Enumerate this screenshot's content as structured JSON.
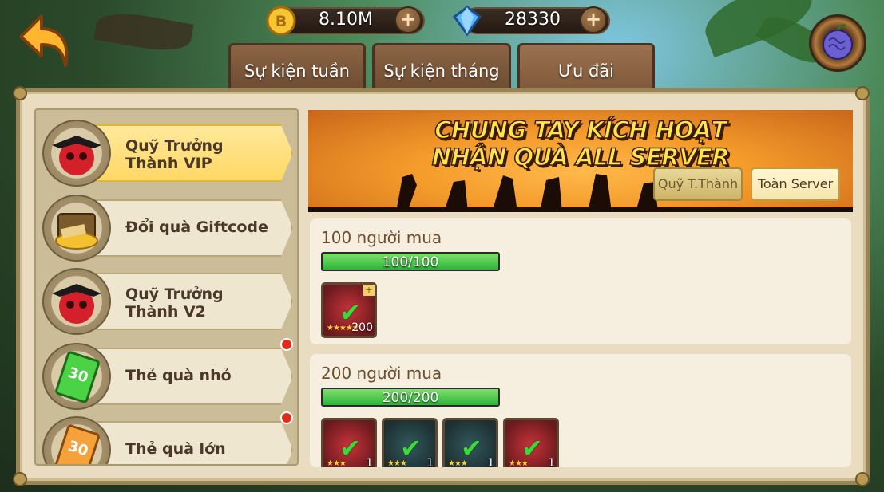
{
  "header": {
    "gold": {
      "value": "8.10M",
      "icon": "coin-icon",
      "color": "#f4c430"
    },
    "gems": {
      "value": "28330",
      "icon": "diamond-icon",
      "color": "#4aa8ff"
    }
  },
  "tabs": [
    {
      "label": "Sự kiện tuần",
      "active": false
    },
    {
      "label": "Sự kiện tháng",
      "active": false
    },
    {
      "label": "Ưu đãi",
      "active": true
    }
  ],
  "sidebar": {
    "items": [
      {
        "label": "Quỹ Trưởng Thành VIP",
        "icon": "pirate-skull-icon",
        "active": true,
        "badge": false
      },
      {
        "label": "Đổi quà Giftcode",
        "icon": "treasure-chest-icon",
        "active": false,
        "badge": false
      },
      {
        "label": "Quỹ Trưởng Thành V2",
        "icon": "pirate-skull-icon",
        "active": false,
        "badge": false
      },
      {
        "label": "Thẻ quà nhỏ",
        "icon": "green-card-icon",
        "active": false,
        "badge": true
      },
      {
        "label": "Thẻ quà lớn",
        "icon": "orange-card-icon",
        "active": false,
        "badge": true
      }
    ]
  },
  "banner": {
    "line1": "CHUNG TAY KÍCH HOẠT",
    "line2": "NHẬN QUÀ ALL SERVER",
    "buttons": [
      {
        "label": "Quỹ T.Thành",
        "active": false
      },
      {
        "label": "Toàn Server",
        "active": true
      }
    ]
  },
  "milestones": [
    {
      "title": "100 người mua",
      "progress_text": "100/100",
      "progress": 1.0,
      "rewards": [
        {
          "icon": "pirate-hat-icon",
          "stars": 5,
          "count": "200",
          "claimed": true
        }
      ]
    },
    {
      "title": "200 người mua",
      "progress_text": "200/200",
      "progress": 1.0,
      "rewards": [
        {
          "icon": "coat-icon",
          "stars": 3,
          "count": "1",
          "claimed": true
        },
        {
          "icon": "coat-icon",
          "stars": 3,
          "count": "1",
          "claimed": true
        },
        {
          "icon": "coat-icon",
          "stars": 3,
          "count": "1",
          "claimed": true
        },
        {
          "icon": "boots-icon",
          "stars": 3,
          "count": "1",
          "claimed": true
        }
      ]
    }
  ]
}
